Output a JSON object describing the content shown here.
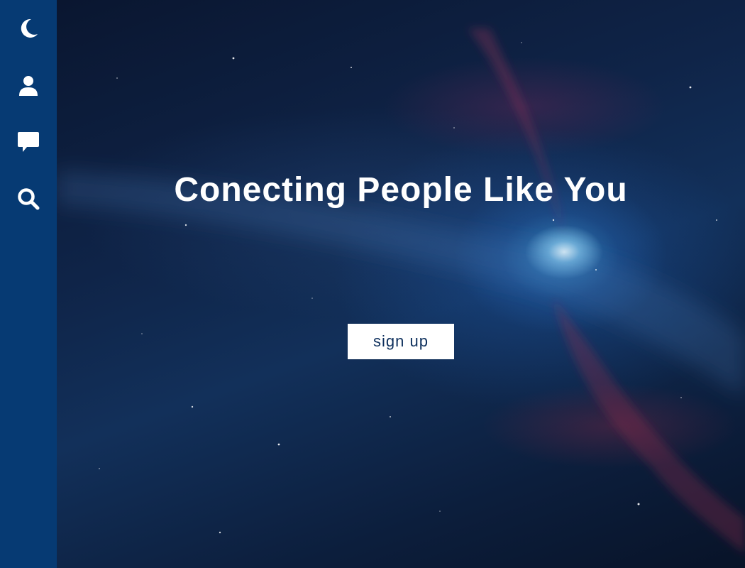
{
  "sidebar": {
    "items": [
      {
        "icon": "moon-icon"
      },
      {
        "icon": "user-icon"
      },
      {
        "icon": "chat-icon"
      },
      {
        "icon": "search-icon"
      }
    ]
  },
  "hero": {
    "headline": "Conecting People Like You",
    "signup_label": "sign up"
  },
  "colors": {
    "sidebar": "#063a73",
    "text": "#ffffff",
    "button_bg": "#ffffff",
    "button_text": "#0d2f5c"
  }
}
